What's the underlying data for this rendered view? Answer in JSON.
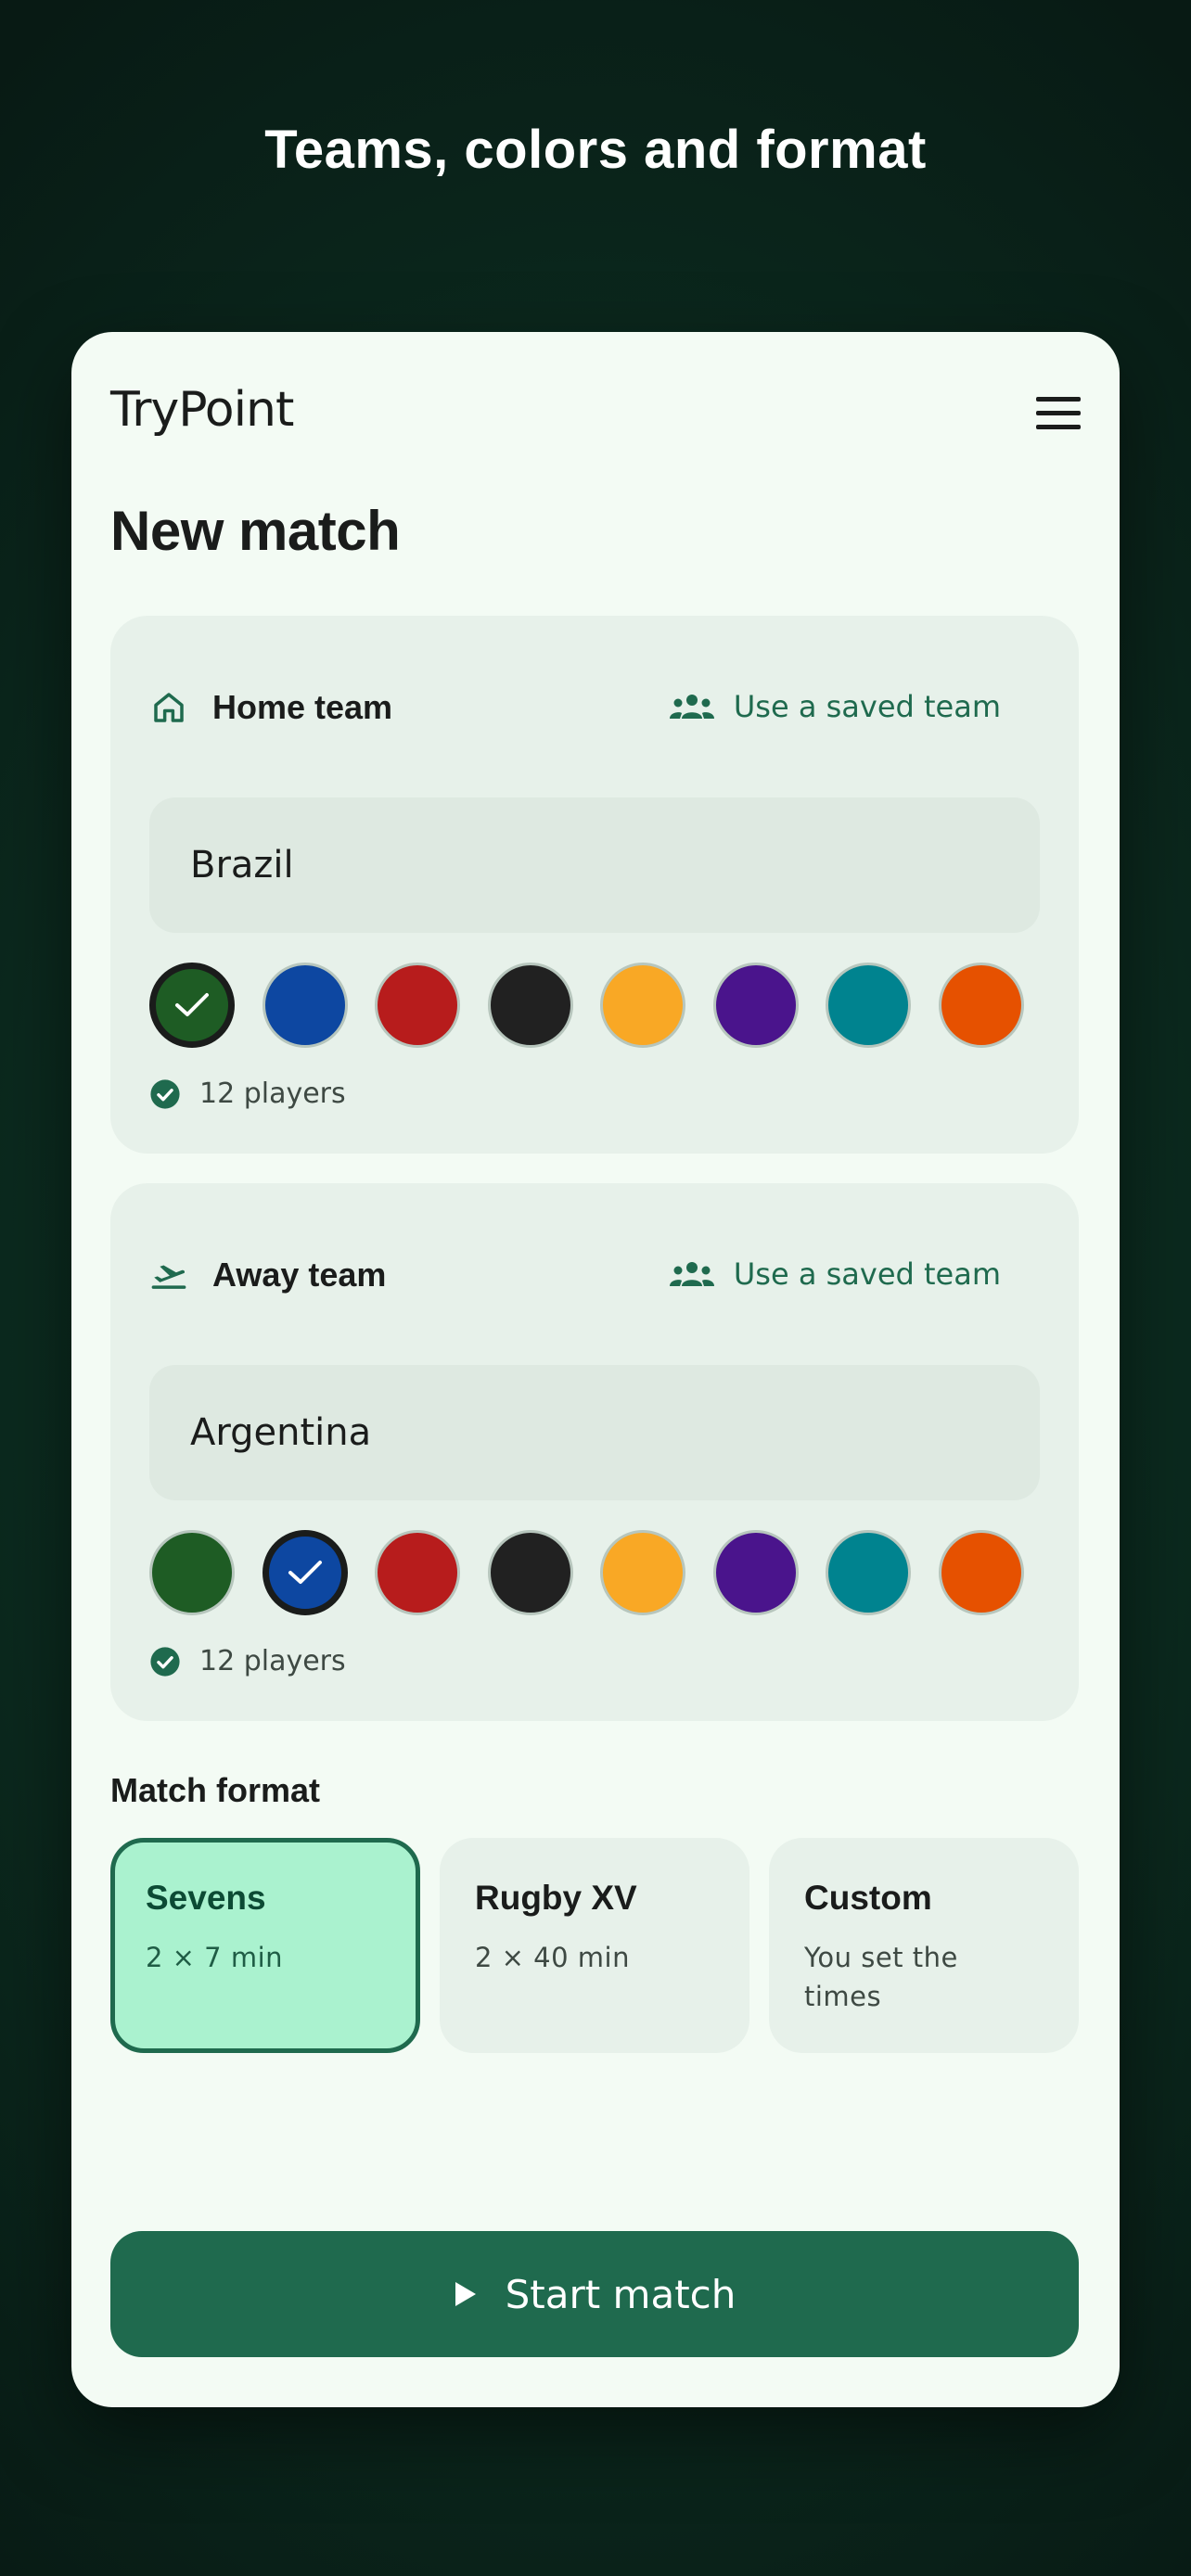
{
  "headline": "Teams, colors and format",
  "app": {
    "name": "TryPoint"
  },
  "page": {
    "title": "New match"
  },
  "home": {
    "label": "Home team",
    "saved_label": "Use a saved team",
    "name_value": "Brazil",
    "selected_color": "#1e5c24",
    "players": "12 players"
  },
  "away": {
    "label": "Away team",
    "saved_label": "Use a saved team",
    "name_value": "Argentina",
    "selected_color": "#0d47a1",
    "players": "12 players"
  },
  "palette": [
    "#1e5c24",
    "#0d47a1",
    "#b71c1c",
    "#212121",
    "#f9a825",
    "#4a148c",
    "#00838f",
    "#e65100"
  ],
  "format": {
    "label": "Match format",
    "options": [
      {
        "name": "Sevens",
        "desc": "2 × 7 min",
        "selected": true
      },
      {
        "name": "Rugby XV",
        "desc": "2 × 40 min",
        "selected": false
      },
      {
        "name": "Custom",
        "desc": "You set the times",
        "selected": false
      }
    ]
  },
  "start_button": {
    "label": "Start match"
  },
  "colors": {
    "accent": "#1f6a4e",
    "surface": "#f3fbf4",
    "card": "#e7f1ea",
    "selected_format": "#aaf2cf"
  }
}
